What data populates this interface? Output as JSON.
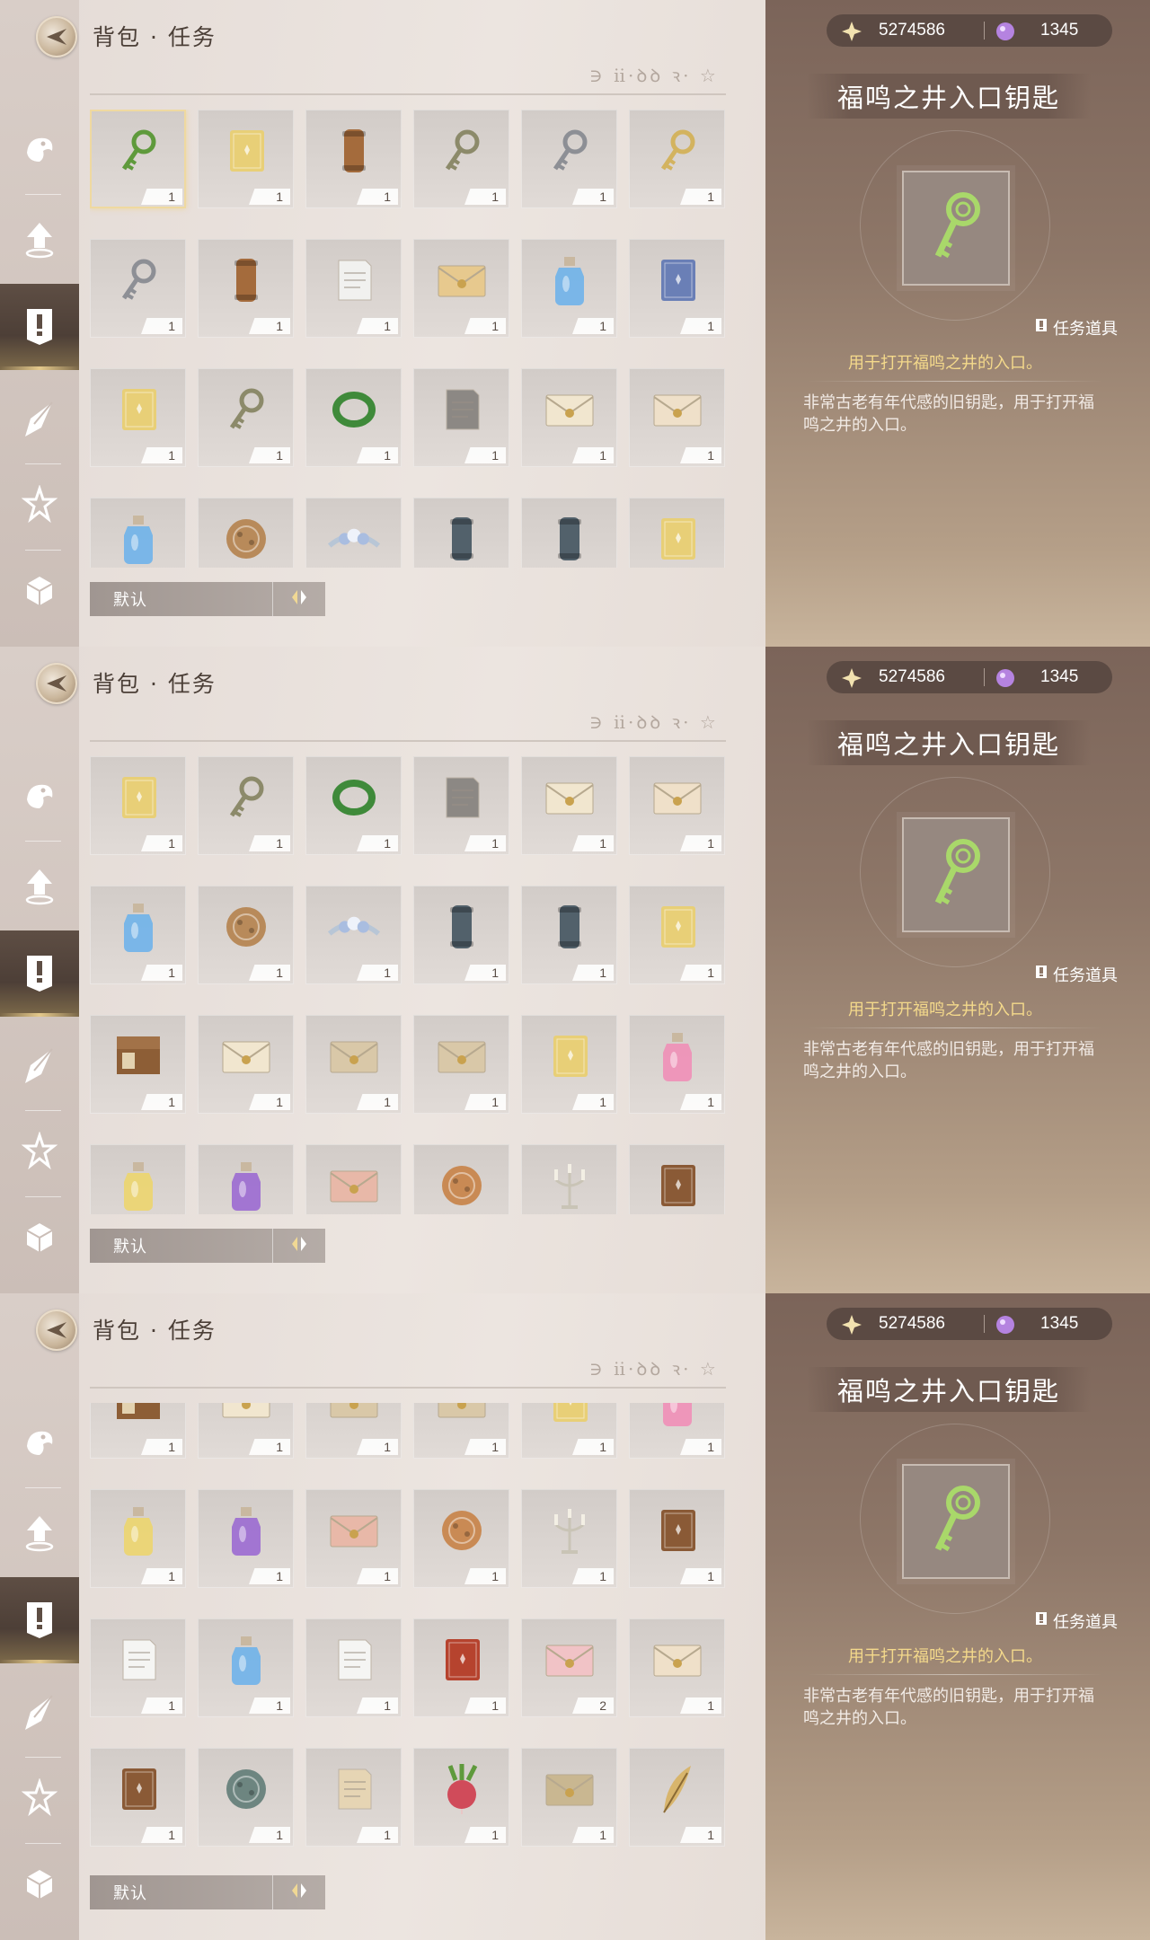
{
  "header": {
    "title": "背包 · 任务",
    "runes": "∋ ⅱ·ꝺꝺ ꝛ· ☆"
  },
  "currency": {
    "gold": "5274586",
    "gems": "1345"
  },
  "detail": {
    "name": "福鸣之井入口钥匙",
    "tag": "任务道具",
    "usage": "用于打开福鸣之井的入口。",
    "description": "非常古老有年代感的旧钥匙，用于打开福鸣之井的入口。"
  },
  "sort": {
    "label": "默认"
  },
  "sidebar": {
    "items": [
      "shell-icon",
      "upload-arrow-icon",
      "quest-exclamation-icon",
      "crystal-feather-icon",
      "star-sparkle-icon",
      "cube-icon"
    ]
  },
  "colors": {
    "accent_gold": "#f4d98b",
    "panel_brown": "#7b6459",
    "slot_bg": "#d8d2ce"
  },
  "panels": [
    {
      "items": [
        {
          "icon": "green-key-icon",
          "qty": "1",
          "selected": true
        },
        {
          "icon": "yellow-book-icon",
          "qty": "1"
        },
        {
          "icon": "scroll-case-icon",
          "qty": "1"
        },
        {
          "icon": "ornate-key-icon",
          "qty": "1"
        },
        {
          "icon": "silver-key-icon",
          "qty": "1"
        },
        {
          "icon": "gold-key-icon",
          "qty": "1"
        },
        {
          "icon": "silver-key-icon",
          "qty": "1"
        },
        {
          "icon": "scroll-case-icon",
          "qty": "1"
        },
        {
          "icon": "white-cloth-icon",
          "qty": "1"
        },
        {
          "icon": "letter-icon",
          "qty": "1"
        },
        {
          "icon": "blue-bottle-icon",
          "qty": "1"
        },
        {
          "icon": "blue-book-icon",
          "qty": "1"
        },
        {
          "icon": "yellow-book-icon",
          "qty": "1"
        },
        {
          "icon": "ornate-key-icon",
          "qty": "1"
        },
        {
          "icon": "green-ring-icon",
          "qty": "1"
        },
        {
          "icon": "gray-paper-icon",
          "qty": "1"
        },
        {
          "icon": "sealed-envelope-icon",
          "qty": "1"
        },
        {
          "icon": "envelope-letter-icon",
          "qty": "1"
        },
        {
          "icon": "blue-bottle-icon",
          "qty": ""
        },
        {
          "icon": "wax-medallion-icon",
          "qty": ""
        },
        {
          "icon": "flower-crown-icon",
          "qty": ""
        },
        {
          "icon": "dark-scroll-icon",
          "qty": ""
        },
        {
          "icon": "dark-scroll-icon",
          "qty": ""
        },
        {
          "icon": "yellow-book-icon",
          "qty": ""
        }
      ]
    },
    {
      "items": [
        {
          "icon": "yellow-book-icon",
          "qty": "1"
        },
        {
          "icon": "ornate-key-icon",
          "qty": "1"
        },
        {
          "icon": "green-ring-icon",
          "qty": "1"
        },
        {
          "icon": "gray-paper-icon",
          "qty": "1"
        },
        {
          "icon": "sealed-envelope-icon",
          "qty": "1"
        },
        {
          "icon": "envelope-letter-icon",
          "qty": "1"
        },
        {
          "icon": "blue-bottle-icon",
          "qty": "1"
        },
        {
          "icon": "wax-medallion-icon",
          "qty": "1"
        },
        {
          "icon": "flower-crown-icon",
          "qty": "1"
        },
        {
          "icon": "dark-scroll-icon",
          "qty": "1"
        },
        {
          "icon": "dark-scroll-icon",
          "qty": "1"
        },
        {
          "icon": "yellow-book-icon",
          "qty": "1"
        },
        {
          "icon": "wooden-box-icon",
          "qty": "1"
        },
        {
          "icon": "sealed-envelope-icon",
          "qty": "1"
        },
        {
          "icon": "folded-letter-icon",
          "qty": "1"
        },
        {
          "icon": "folded-letter-icon",
          "qty": "1"
        },
        {
          "icon": "yellow-book-icon",
          "qty": "1"
        },
        {
          "icon": "pink-jar-icon",
          "qty": "1"
        },
        {
          "icon": "yellow-jar-icon",
          "qty": ""
        },
        {
          "icon": "purple-jar-icon",
          "qty": ""
        },
        {
          "icon": "photo-card-icon",
          "qty": ""
        },
        {
          "icon": "cake-icon",
          "qty": ""
        },
        {
          "icon": "candelabra-icon",
          "qty": ""
        },
        {
          "icon": "brown-book-icon",
          "qty": ""
        }
      ]
    },
    {
      "items": [
        {
          "icon": "wooden-box-icon",
          "qty": "1"
        },
        {
          "icon": "sealed-envelope-icon",
          "qty": "1"
        },
        {
          "icon": "folded-letter-icon",
          "qty": "1"
        },
        {
          "icon": "folded-letter-icon",
          "qty": "1"
        },
        {
          "icon": "yellow-book-icon",
          "qty": "1"
        },
        {
          "icon": "pink-jar-icon",
          "qty": "1"
        },
        {
          "icon": "yellow-jar-icon",
          "qty": "1"
        },
        {
          "icon": "purple-jar-icon",
          "qty": "1"
        },
        {
          "icon": "photo-card-icon",
          "qty": "1"
        },
        {
          "icon": "cake-icon",
          "qty": "1"
        },
        {
          "icon": "candelabra-icon",
          "qty": "1"
        },
        {
          "icon": "brown-book-icon",
          "qty": "1"
        },
        {
          "icon": "paper-sheet-icon",
          "qty": "1"
        },
        {
          "icon": "blue-bottle-icon",
          "qty": "1"
        },
        {
          "icon": "paper-sheet-icon",
          "qty": "1"
        },
        {
          "icon": "red-book-icon",
          "qty": "1"
        },
        {
          "icon": "pink-card-icon",
          "qty": "2"
        },
        {
          "icon": "envelope-letter-icon",
          "qty": "1"
        },
        {
          "icon": "brown-book-icon",
          "qty": "1"
        },
        {
          "icon": "compass-icon",
          "qty": "1"
        },
        {
          "icon": "handwritten-note-icon",
          "qty": "1"
        },
        {
          "icon": "radish-icon",
          "qty": "1"
        },
        {
          "icon": "silhouette-card-icon",
          "qty": "1"
        },
        {
          "icon": "feather-quill-icon",
          "qty": "1"
        }
      ]
    }
  ]
}
